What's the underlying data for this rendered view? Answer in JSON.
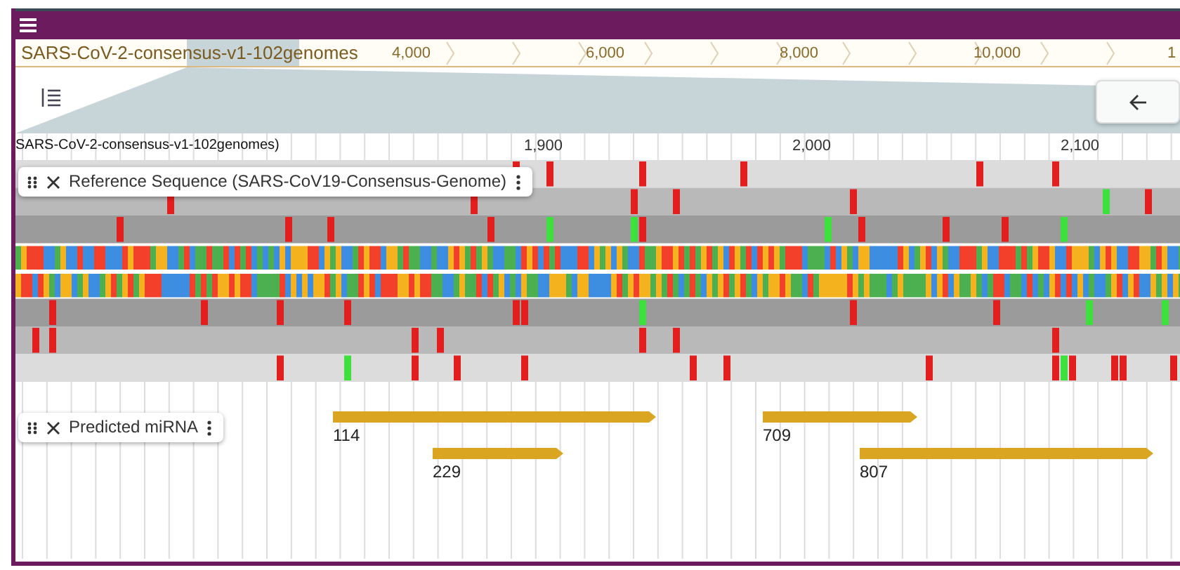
{
  "overview": {
    "assembly_label": "SARS-CoV-2-consensus-v1-102genomes",
    "ticks": [
      "4,000",
      "6,000",
      "8,000",
      "10,000",
      "1"
    ]
  },
  "ruler": {
    "assembly_label": "SARS-CoV-2-consensus-v1-102genomes)",
    "ticks": [
      "1,900",
      "2,000",
      "2,100"
    ]
  },
  "tracks": [
    {
      "kind": "sequence",
      "title": "Reference Sequence (SARS-CoV19-Consensus-Genome)"
    },
    {
      "kind": "features",
      "title": "Predicted miRNA",
      "features": [
        {
          "label": "114"
        },
        {
          "label": "229"
        },
        {
          "label": "709"
        },
        {
          "label": "807"
        }
      ]
    }
  ]
}
